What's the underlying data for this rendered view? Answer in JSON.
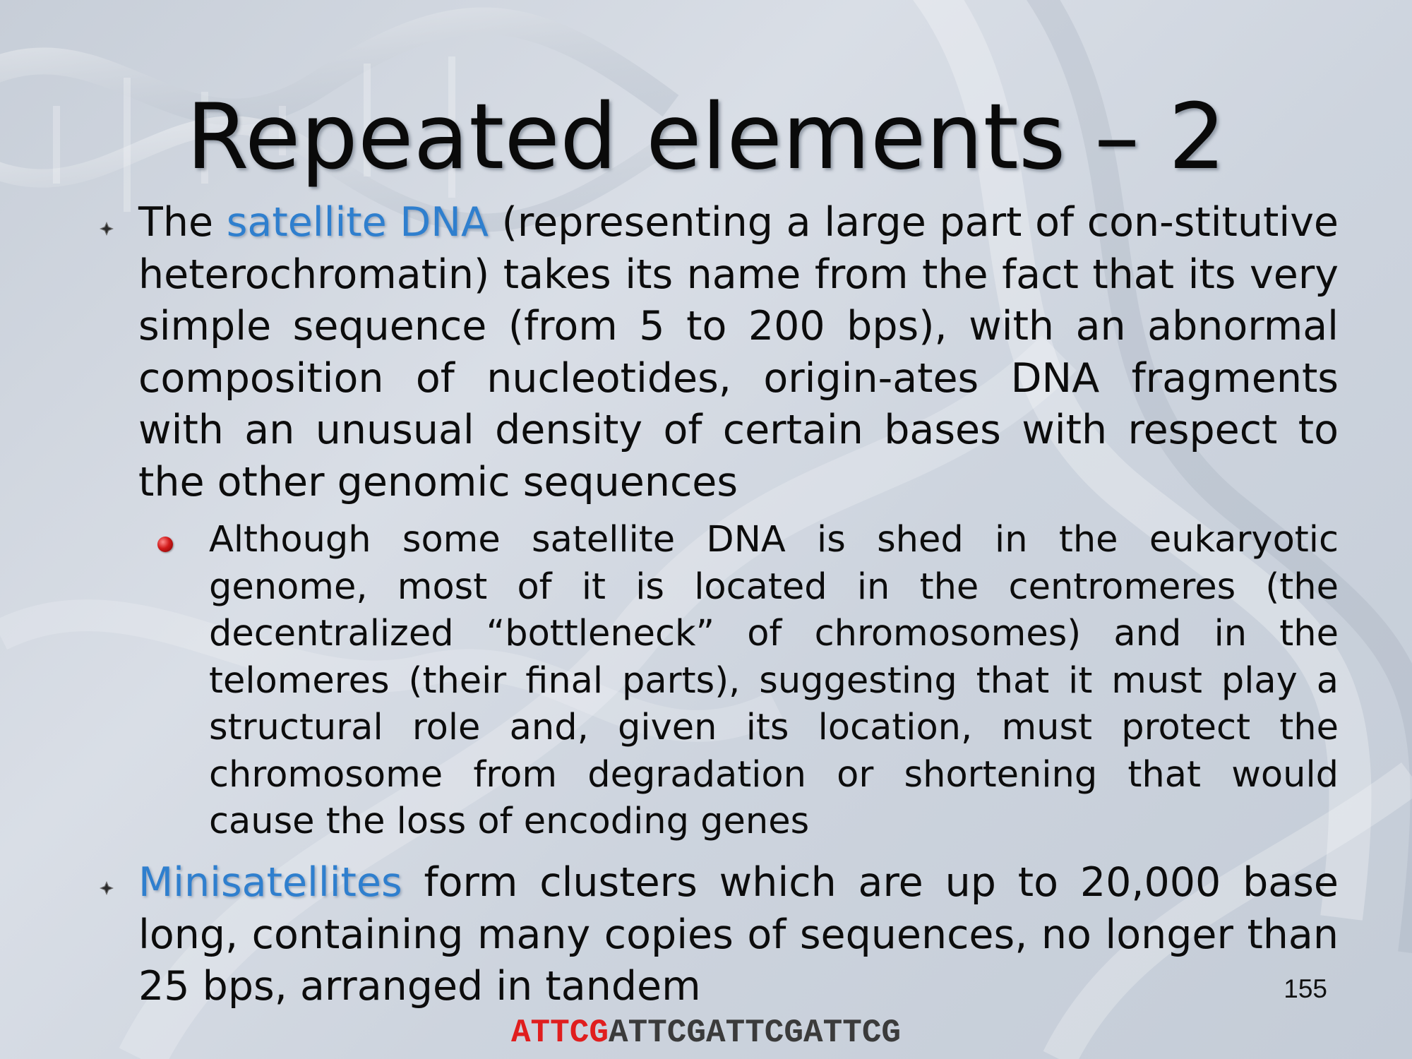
{
  "slide": {
    "title": "Repeated elements – 2",
    "page_number": "155"
  },
  "bullets": [
    {
      "highlight": "satellite DNA",
      "lead": "The ",
      "text": " (representing a large part of con-stitutive heterochromatin) takes its name from the fact that its very simple sequence (from 5 to 200 bps), with an abnormal composition of nucleotides, origin-ates DNA fragments with an unusual density of certain bases with respect to the other genomic sequences",
      "sub_bullet": "Although some satellite DNA is shed in the eukaryotic genome, most of it is located in the centromeres (the decentralized “bottleneck” of chromosomes) and in the telomeres (their final parts), suggesting that it must play a structural role and, given its location, must protect the chromosome from degradation or shortening that would cause the loss of encoding genes"
    },
    {
      "highlight": "Minisatellites",
      "text": " form clusters which are up to 20,000 base long, containing many copies of sequences, no longer than 25 bps, arranged in tandem"
    }
  ],
  "sequence": {
    "highlighted": "ATTCG",
    "rest": "ATTCGATTCGATTCG"
  },
  "colors": {
    "highlight": "#2f7fce",
    "sequence_highlight": "#e01e1e",
    "bullet_sub": "#d21a1a"
  },
  "icons": {
    "main_bullet": "diamond-star-bullet-icon",
    "sub_bullet": "red-sphere-bullet-icon",
    "background": "dna-helix-background"
  }
}
